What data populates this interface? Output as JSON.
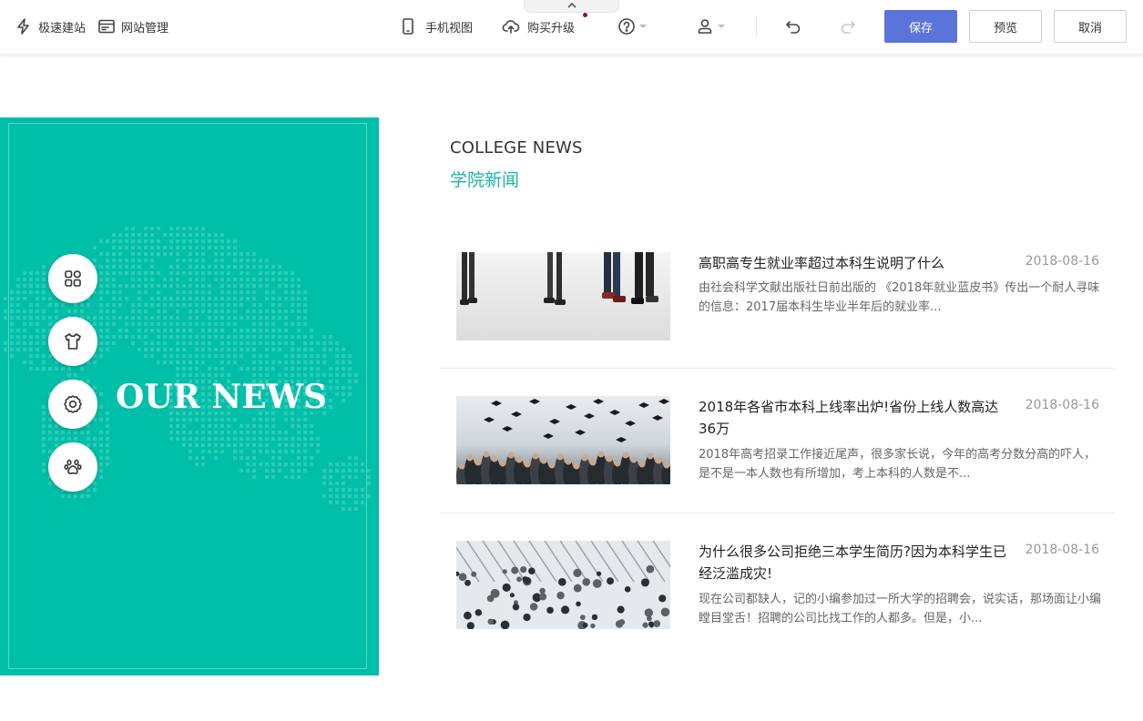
{
  "toolbar": {
    "quick_build": "极速建站",
    "site_manage": "网站管理",
    "mobile_view": "手机视图",
    "upgrade": "购买升级",
    "save": "保存",
    "preview": "预览",
    "cancel": "取消"
  },
  "colors": {
    "primary": "#5b74d9",
    "banner": "#00bfa8",
    "accent_text": "#19b5a0"
  },
  "banner": {
    "title": "OUR NEWS"
  },
  "section": {
    "title_en": "COLLEGE NEWS",
    "title_cn": "学院新闻"
  },
  "news": [
    {
      "title": "高职高专生就业率超过本科生说明了什么",
      "date": "2018-08-16",
      "desc": "由社会科学文献出版社日前出版的 《2018年就业蓝皮书》传出一个耐人寻味的信息：2017届本科生毕业半年后的就业率..."
    },
    {
      "title": "2018年各省市本科上线率出炉!省份上线人数高达36万",
      "date": "2018-08-16",
      "desc": "2018年高考招录工作接近尾声，很多家长说，今年的高考分数分高的吓人，是不是一本人数也有所增加，考上本科的人数是不..."
    },
    {
      "title": "为什么很多公司拒绝三本学生简历?因为本科学生已经泛滥成灾!",
      "date": "2018-08-16",
      "desc": "现在公司都缺人，记的小编参加过一所大学的招聘会，说实话，那场面让小编瞠目堂舌！招聘的公司比找工作的人都多。但是，小..."
    }
  ]
}
